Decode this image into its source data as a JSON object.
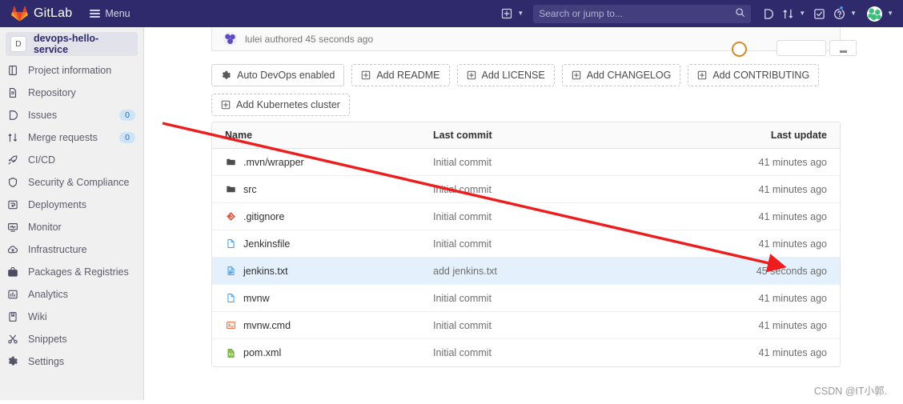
{
  "topbar": {
    "brand": "GitLab",
    "menu_label": "Menu",
    "logo_icon": "gitlab-tanuki-logo",
    "hamburger_icon": "hamburger-menu-icon",
    "plus_icon": "plus-square-icon",
    "search": {
      "placeholder": "Search or jump to...",
      "value": "",
      "icon": "search-icon"
    },
    "issues_icon": "issues-icon",
    "merge_requests_icon": "merge-request-icon",
    "todos_icon": "todos-checkbox-icon",
    "help_icon": "help-question-icon",
    "avatar_icon": "user-avatar",
    "caret_icon": "chevron-down-icon"
  },
  "sidebar": {
    "project": {
      "initial": "D",
      "name": "devops-hello-service"
    },
    "items": [
      {
        "label": "Project information",
        "icon": "project-information-icon",
        "badge": ""
      },
      {
        "label": "Repository",
        "icon": "repository-icon",
        "badge": ""
      },
      {
        "label": "Issues",
        "icon": "issues-icon",
        "badge": "0"
      },
      {
        "label": "Merge requests",
        "icon": "merge-request-icon",
        "badge": "0"
      },
      {
        "label": "CI/CD",
        "icon": "rocket-icon",
        "badge": ""
      },
      {
        "label": "Security & Compliance",
        "icon": "shield-icon",
        "badge": ""
      },
      {
        "label": "Deployments",
        "icon": "deployments-icon",
        "badge": ""
      },
      {
        "label": "Monitor",
        "icon": "monitor-icon",
        "badge": ""
      },
      {
        "label": "Infrastructure",
        "icon": "cloud-infrastructure-icon",
        "badge": ""
      },
      {
        "label": "Packages & Registries",
        "icon": "package-icon",
        "badge": ""
      },
      {
        "label": "Analytics",
        "icon": "analytics-chart-icon",
        "badge": ""
      },
      {
        "label": "Wiki",
        "icon": "wiki-book-icon",
        "badge": ""
      },
      {
        "label": "Snippets",
        "icon": "snippets-scissors-icon",
        "badge": ""
      },
      {
        "label": "Settings",
        "icon": "gear-icon",
        "badge": ""
      }
    ]
  },
  "main": {
    "commit_author_line": "lulei authored 45 seconds ago",
    "commit_avatar_icon": "commit-author-avatar",
    "pipeline_status_icon": "pipeline-running-icon",
    "actions": [
      {
        "label": "Auto DevOps enabled",
        "icon": "gear-icon",
        "style": "solid"
      },
      {
        "label": "Add README",
        "icon": "plus-square-icon",
        "style": "dashed"
      },
      {
        "label": "Add LICENSE",
        "icon": "plus-square-icon",
        "style": "dashed"
      },
      {
        "label": "Add CHANGELOG",
        "icon": "plus-square-icon",
        "style": "dashed"
      },
      {
        "label": "Add CONTRIBUTING",
        "icon": "plus-square-icon",
        "style": "dashed"
      },
      {
        "label": "Add Kubernetes cluster",
        "icon": "plus-square-icon",
        "style": "dashed"
      }
    ],
    "table": {
      "headers": {
        "name": "Name",
        "last_commit": "Last commit",
        "last_update": "Last update"
      },
      "rows": [
        {
          "name": ".mvn/wrapper",
          "icon": "folder-icon",
          "last_commit": "Initial commit",
          "last_update": "41 minutes ago",
          "highlighted": false
        },
        {
          "name": "src",
          "icon": "folder-icon",
          "last_commit": "Initial commit",
          "last_update": "41 minutes ago",
          "highlighted": false
        },
        {
          "name": ".gitignore",
          "icon": "git-file-icon",
          "last_commit": "Initial commit",
          "last_update": "41 minutes ago",
          "highlighted": false
        },
        {
          "name": "Jenkinsfile",
          "icon": "file-blank-icon",
          "last_commit": "Initial commit",
          "last_update": "41 minutes ago",
          "highlighted": false
        },
        {
          "name": "jenkins.txt",
          "icon": "text-file-icon",
          "last_commit": "add jenkins.txt",
          "last_update": "45 seconds ago",
          "highlighted": true
        },
        {
          "name": "mvnw",
          "icon": "file-blank-icon",
          "last_commit": "Initial commit",
          "last_update": "41 minutes ago",
          "highlighted": false
        },
        {
          "name": "mvnw.cmd",
          "icon": "terminal-file-icon",
          "last_commit": "Initial commit",
          "last_update": "41 minutes ago",
          "highlighted": false
        },
        {
          "name": "pom.xml",
          "icon": "xml-file-icon",
          "last_commit": "Initial commit",
          "last_update": "41 minutes ago",
          "highlighted": false
        }
      ]
    }
  },
  "annotation": {
    "arrow_icon": "red-arrow-annotation",
    "color": "#ee1c1c"
  },
  "watermark": {
    "text": "CSDN @IT小郭."
  },
  "colors": {
    "topbar_bg": "#2f2a6b",
    "sidebar_bg": "#f0f0f0",
    "highlight_row": "#e4f0fb",
    "badge_bg": "#cfe3f7",
    "annotation_red": "#ee1c1c"
  }
}
